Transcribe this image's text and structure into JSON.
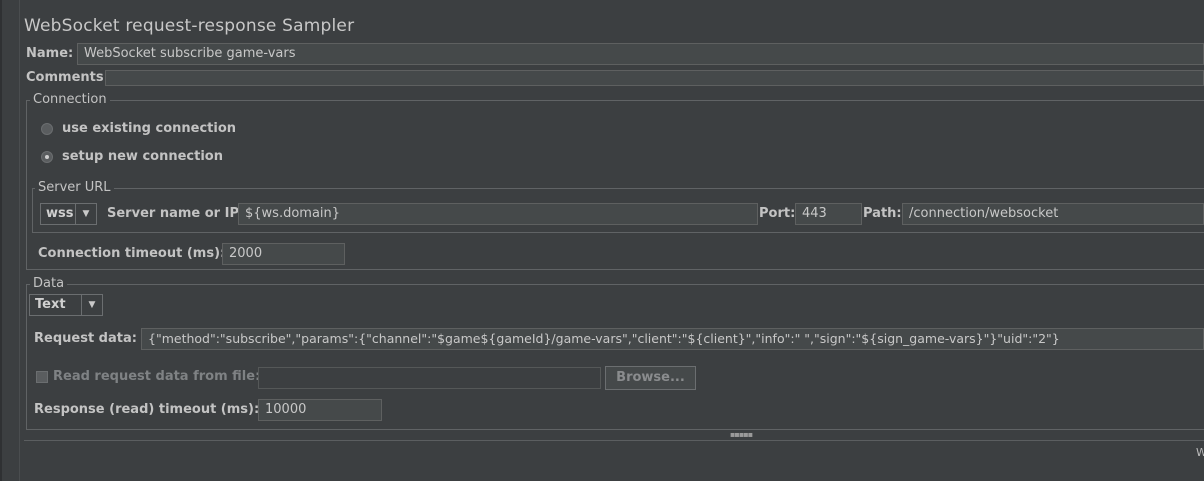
{
  "title": "WebSocket request-response Sampler",
  "name_label": "Name:",
  "name_value": "WebSocket subscribe game-vars",
  "comments_label": "Comments:",
  "connection": {
    "legend": "Connection",
    "option_existing": "use existing connection",
    "option_new": "setup new connection",
    "selected": "setup new connection"
  },
  "server_url": {
    "legend": "Server URL",
    "scheme": "wss",
    "server_label": "Server name or IP:",
    "server_value": "${ws.domain}",
    "port_label": "Port:",
    "port_value": "443",
    "path_label": "Path:",
    "path_value": "/connection/websocket"
  },
  "timeout": {
    "label": "Connection timeout (ms):",
    "value": "2000"
  },
  "data": {
    "legend": "Data",
    "type": "Text",
    "request_label": "Request data:",
    "request_value": "{\"method\":\"subscribe\",\"params\":{\"channel\":\"$game${gameId}/game-vars\",\"client\":\"${client}\",\"info\":\" \",\"sign\":\"${sign_game-vars}\"}\"uid\":\"2\"}",
    "read_file_label": "Read request data from file:",
    "read_file_value": "",
    "browse_label": "Browse...",
    "response_label": "Response (read) timeout (ms):",
    "response_value": "10000"
  },
  "footer_text": "W"
}
